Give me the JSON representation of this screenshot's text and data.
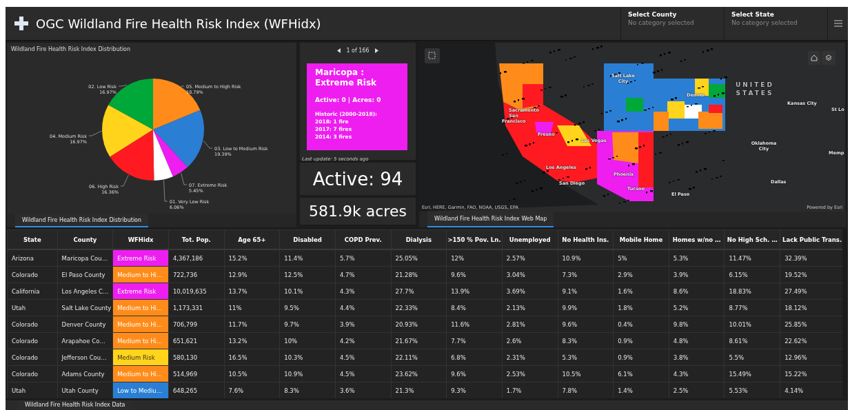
{
  "header": {
    "title": "OGC Wildland Fire Health Risk Index (WFHidx)",
    "selectors": [
      {
        "label": "Select County",
        "value": "No category selected"
      },
      {
        "label": "Select State",
        "value": "No category selected"
      }
    ]
  },
  "distribution": {
    "title": "Wildland Fire Health Risk Index Distribution",
    "tab": {
      "label": "Wildland Fire Health Risk Index Distribution",
      "selected": true
    },
    "chart_data": {
      "type": "pie",
      "categories": [
        "05. Medium to High Risk",
        "03. Low to Medium Risk",
        "07. Extreme Risk",
        "01. Very Low Risk",
        "06. High Risk",
        "04. Medium Risk",
        "02. Low Risk"
      ],
      "values": [
        18.79,
        19.39,
        5.45,
        6.06,
        16.36,
        16.97,
        16.97
      ],
      "colors": [
        "#ff8c1a",
        "#2a7fd4",
        "#ee1ef0",
        "#ffffff",
        "#ff1a22",
        "#ffd41a",
        "#00a83a"
      ],
      "value_labels": [
        "18.79%",
        "19.39%",
        "5.45%",
        "6.06%",
        "16.36%",
        "16.97%",
        "16.97%"
      ]
    }
  },
  "details": {
    "pager": "1 of 166",
    "popup": {
      "title": "Maricopa : Extreme Risk",
      "color": "#ee1ef0",
      "summary": "Active: 0 | Acres: 0",
      "history_title": "Historic (2000-2018):",
      "history": [
        "2018: 1 fire",
        "2017: 7 fires",
        "2014: 3 fires"
      ]
    },
    "last_update": "Last update: 5 seconds ago"
  },
  "active_fires": "Active: 94",
  "acres": "581.9k acres",
  "map": {
    "tab": {
      "label": "Wildland Fire Health Risk Index Web Map",
      "selected": true
    },
    "labels": [
      {
        "text": "UNITED STATES",
        "kind": "country"
      },
      {
        "text": "Kansas City",
        "kind": "city"
      },
      {
        "text": "St Lo",
        "kind": "city"
      },
      {
        "text": "Oklahoma City",
        "kind": "city"
      },
      {
        "text": "Memp",
        "kind": "city"
      },
      {
        "text": "Dallas",
        "kind": "city"
      },
      {
        "text": "El Paso",
        "kind": "city"
      },
      {
        "text": "Salt Lake City",
        "kind": "city"
      },
      {
        "text": "Denver",
        "kind": "city"
      },
      {
        "text": "Sacramento",
        "kind": "city"
      },
      {
        "text": "San Francisco",
        "kind": "city"
      },
      {
        "text": "Fresno",
        "kind": "city"
      },
      {
        "text": "Las Vegas",
        "kind": "city"
      },
      {
        "text": "Los Angeles",
        "kind": "city"
      },
      {
        "text": "Phoenix",
        "kind": "city"
      },
      {
        "text": "San Diego",
        "kind": "city"
      },
      {
        "text": "Tucson",
        "kind": "city"
      }
    ],
    "attribution": "Esri, HERE, Garmin, FAO, NOAA, USGS, EPA",
    "powered_by": "Powered by Esri"
  },
  "table": {
    "tab": {
      "label": "Wildland Fire Health Risk Index Data",
      "selected": false
    },
    "columns": [
      "State",
      "County",
      "WFHidx",
      "Tot. Pop.",
      "Age 65+",
      "Disabled",
      "COPD Prev.",
      "Dialysis",
      ">150 % Pov. Ln.",
      "Unemployed",
      "No Health Ins.",
      "Mobile Home",
      "Homes w/no …",
      "No High Sch. …",
      "Lack Public Trans."
    ],
    "rows": [
      {
        "cells": [
          "Arizona",
          "Maricopa Cou…",
          "Extreme Risk",
          "4,367,186",
          "15.2%",
          "11.4%",
          "5.7%",
          "25.05%",
          "12%",
          "2.57%",
          "10.9%",
          "5%",
          "5.3%",
          "11.47%",
          "32.39%"
        ],
        "color": "#ee1ef0"
      },
      {
        "cells": [
          "Colorado",
          "El Paso County",
          "Medium to Hi…",
          "722,736",
          "12.9%",
          "12.5%",
          "4.7%",
          "21.28%",
          "9.6%",
          "3.04%",
          "7.3%",
          "2.9%",
          "3.9%",
          "6.15%",
          "19.52%"
        ],
        "color": "#ff8c1a"
      },
      {
        "cells": [
          "California",
          "Los Angeles C…",
          "Extreme Risk",
          "10,019,635",
          "13.7%",
          "10.1%",
          "4.3%",
          "27.7%",
          "13.9%",
          "3.69%",
          "9.1%",
          "1.6%",
          "8.6%",
          "18.83%",
          "27.49%"
        ],
        "color": "#ee1ef0"
      },
      {
        "cells": [
          "Utah",
          "Salt Lake County",
          "Medium to Hi…",
          "1,173,331",
          "11%",
          "9.5%",
          "4.4%",
          "22.33%",
          "8.4%",
          "2.13%",
          "9.9%",
          "1.8%",
          "5.2%",
          "8.77%",
          "18.12%"
        ],
        "color": "#ff8c1a"
      },
      {
        "cells": [
          "Colorado",
          "Denver County",
          "Medium to Hi…",
          "706,799",
          "11.7%",
          "9.7%",
          "3.9%",
          "20.93%",
          "11.6%",
          "2.81%",
          "9.6%",
          "0.4%",
          "9.8%",
          "10.01%",
          "25.85%"
        ],
        "color": "#ff8c1a"
      },
      {
        "cells": [
          "Colorado",
          "Arapahoe Co…",
          "Medium to Hi…",
          "651,621",
          "13.2%",
          "10%",
          "4.2%",
          "21.67%",
          "7.7%",
          "2.6%",
          "8.3%",
          "0.9%",
          "4.8%",
          "8.61%",
          "22.62%"
        ],
        "color": "#ff8c1a"
      },
      {
        "cells": [
          "Colorado",
          "Jefferson Cou…",
          "Medium Risk",
          "580,130",
          "16.5%",
          "10.3%",
          "4.5%",
          "22.11%",
          "6.8%",
          "2.31%",
          "5.3%",
          "0.9%",
          "3.8%",
          "5.5%",
          "12.96%"
        ],
        "color": "#ffd41a"
      },
      {
        "cells": [
          "Colorado",
          "Adams County",
          "Medium to Hi…",
          "514,969",
          "10.5%",
          "10.9%",
          "4.5%",
          "23.62%",
          "9.6%",
          "2.53%",
          "10.5%",
          "6.1%",
          "4.3%",
          "15.49%",
          "15.22%"
        ],
        "color": "#ff8c1a"
      },
      {
        "cells": [
          "Utah",
          "Utah County",
          "Low to Mediu…",
          "648,265",
          "7.6%",
          "8.3%",
          "3.6%",
          "21.3%",
          "9.3%",
          "1.7%",
          "7.8%",
          "1.4%",
          "2.5%",
          "5.53%",
          "4.14%"
        ],
        "color": "#2a7fd4"
      }
    ]
  }
}
